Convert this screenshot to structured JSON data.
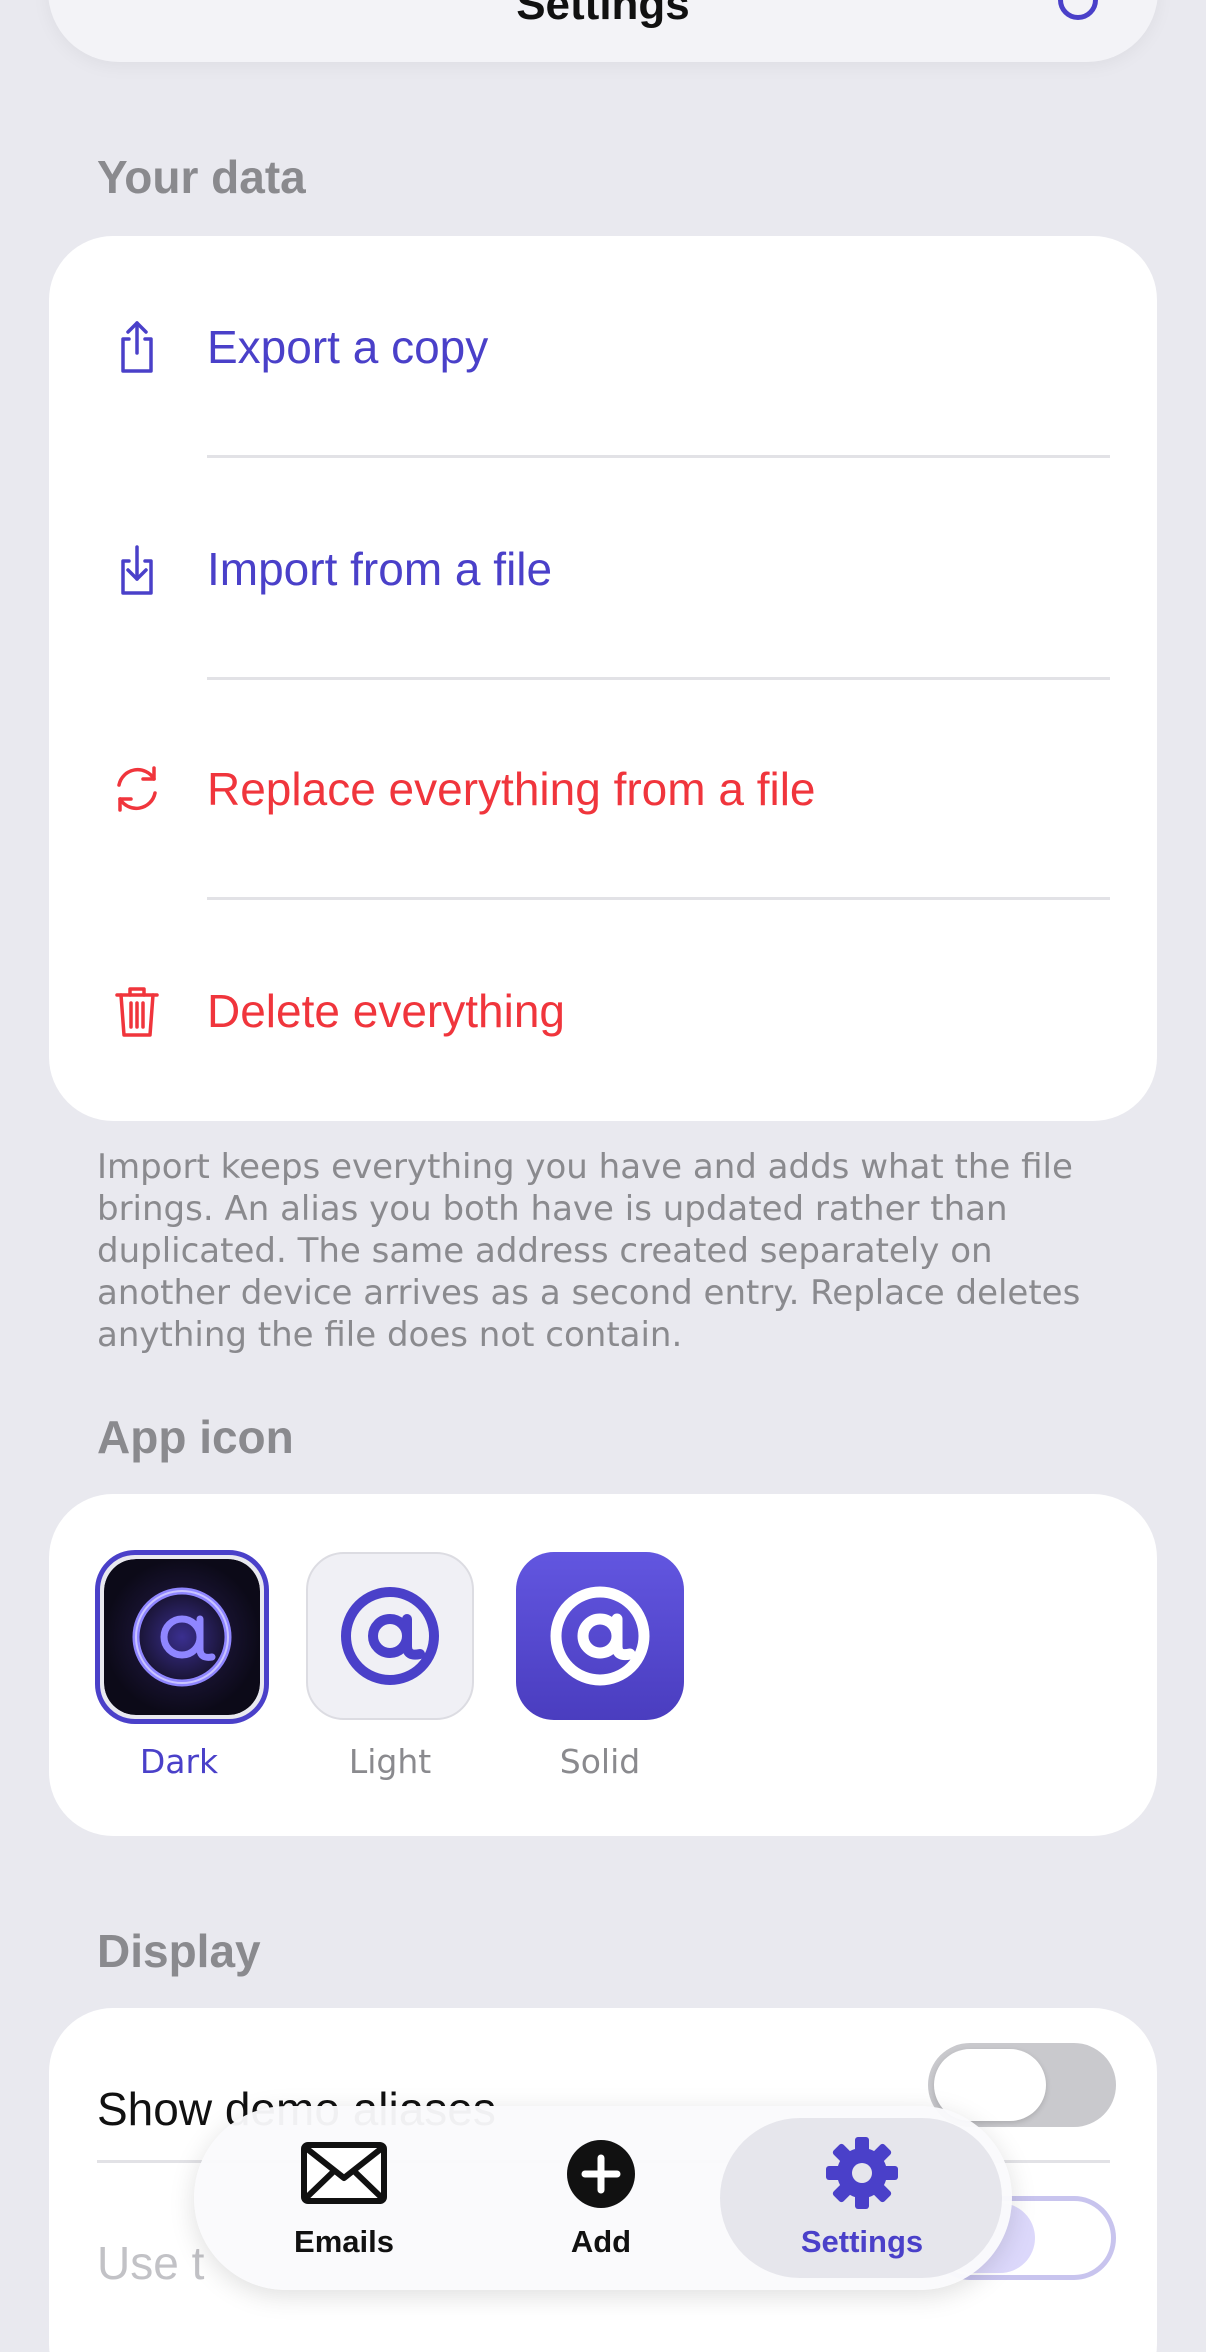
{
  "nav": {
    "title": "Settings"
  },
  "your_data": {
    "header": "Your data",
    "items": [
      {
        "label": "Export a copy",
        "icon": "share-icon",
        "tone": "indigo"
      },
      {
        "label": "Import from a file",
        "icon": "import-icon",
        "tone": "indigo"
      },
      {
        "label": "Replace everything from a file",
        "icon": "sync-icon",
        "tone": "red"
      },
      {
        "label": "Delete everything",
        "icon": "trash-icon",
        "tone": "red"
      }
    ],
    "footnote": "Import keeps everything you have and adds what the file brings. An alias you both have is updated rather than duplicated. The same address created separately on another device arrives as a second entry. Replace deletes anything the file does not contain."
  },
  "app_icon": {
    "header": "App icon",
    "options": [
      {
        "label": "Dark",
        "selected": true
      },
      {
        "label": "Light",
        "selected": false
      },
      {
        "label": "Solid",
        "selected": false
      }
    ]
  },
  "display": {
    "header": "Display",
    "rows": [
      {
        "label": "Show demo aliases",
        "on": false
      },
      {
        "label": "Use t",
        "on": false
      }
    ]
  },
  "tabbar": {
    "tabs": [
      {
        "label": "Emails",
        "icon": "envelope-icon",
        "selected": false
      },
      {
        "label": "Add",
        "icon": "plus-circle-icon",
        "selected": false
      },
      {
        "label": "Settings",
        "icon": "gear-icon",
        "selected": true
      }
    ]
  },
  "colors": {
    "accent": "#4a40c9",
    "destructive": "#f0353c",
    "background": "#e9e9ef",
    "card": "#ffffff",
    "secondary_text": "#8a8a8e"
  }
}
